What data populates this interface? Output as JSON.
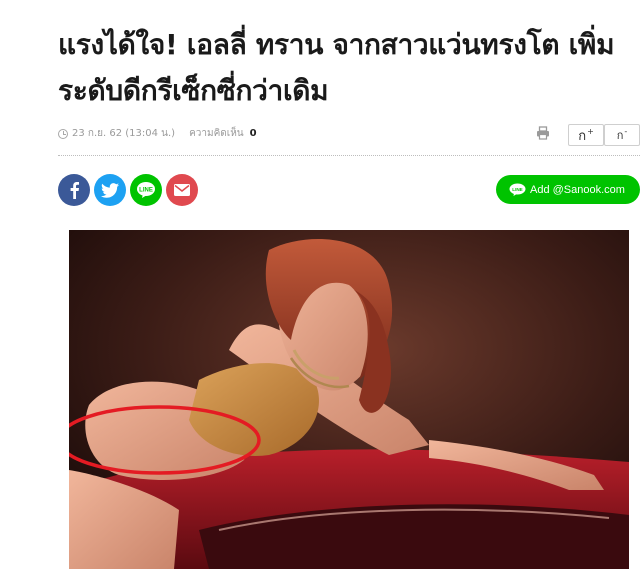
{
  "article": {
    "headline": "แรงได้ใจ! เอลลี่ ทราน จากสาวแว่นทรงโต เพิ่มระดับดีกรีเซ็กซี่กว่าเดิม",
    "date": "23 ก.ย. 62 (13:04 น.)",
    "comment_label": "ความคิดเห็น",
    "comment_count": "0"
  },
  "toolbar": {
    "font_increase_label": "ก",
    "font_increase_sign": "+",
    "font_decrease_label": "ก",
    "font_decrease_sign": "-"
  },
  "share": {
    "add_line_label": "Add @Sanook.com"
  },
  "colors": {
    "facebook": "#3b5998",
    "twitter": "#1da1f2",
    "line": "#00c300",
    "mail": "#e0494f",
    "highlight_circle": "#e41b23"
  },
  "icons": [
    "clock-icon",
    "print-icon",
    "facebook-icon",
    "twitter-icon",
    "line-icon",
    "mail-icon",
    "line-bubble-icon"
  ]
}
